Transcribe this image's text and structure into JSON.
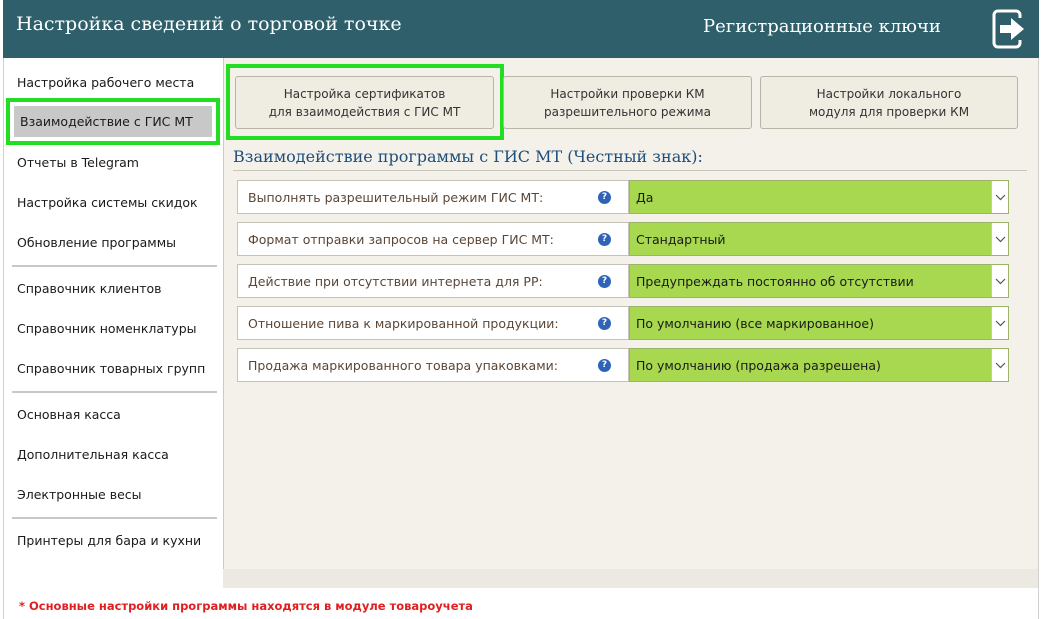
{
  "header": {
    "title": "Настройка сведений о торговой точке",
    "keys_label": "Регистрационные ключи",
    "exit_icon": "exit-door-icon"
  },
  "sidebar": {
    "items": [
      "Настройка рабочего места",
      "Взаимодействие с ГИС МТ",
      "Отчеты в Telegram",
      "Настройка системы скидок",
      "Обновление программы",
      "Справочник клиентов",
      "Справочник номенклатуры",
      "Справочник товарных групп",
      "Основная касса",
      "Дополнительная касса",
      "Электронные весы",
      "Принтеры для бара и кухни"
    ],
    "active_index": 1
  },
  "tabs": [
    {
      "line1": "Настройка сертификатов",
      "line2": "для взаимодействия с ГИС МТ"
    },
    {
      "line1": "Настройки проверки КМ",
      "line2": "разрешительного режима"
    },
    {
      "line1": "Настройки локального",
      "line2": "модуля для проверки КМ"
    }
  ],
  "section": {
    "title": "Взаимодействие программы с ГИС МТ (Честный знак):"
  },
  "settings": [
    {
      "label": "Выполнять разрешительный режим ГИС МТ:",
      "value": "Да"
    },
    {
      "label": "Формат отправки запросов на сервер ГИС МТ:",
      "value": "Стандартный"
    },
    {
      "label": "Действие при отсутствии интернета для РР:",
      "value": "Предупреждать постоянно об отсутствии"
    },
    {
      "label": "Отношение пива к маркированной продукции:",
      "value": "По умолчанию (все маркированное)"
    },
    {
      "label": "Продажа маркированного товара упаковками:",
      "value": "По умолчанию (продажа разрешена)"
    }
  ],
  "help_glyph": "?",
  "footnote": "* Основные настройки программы находятся в модуле товароучета",
  "colors": {
    "header_bg": "#2e5f6a",
    "highlight": "#22dd22",
    "select_bg": "#a8d84f",
    "footnote": "#e02020",
    "section_title": "#1f4e79"
  }
}
